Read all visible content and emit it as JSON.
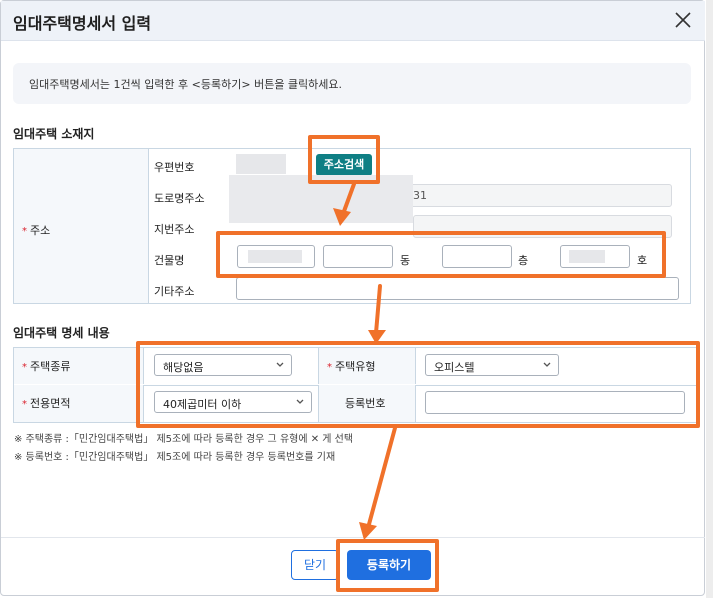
{
  "dialog": {
    "title": "임대주택명세서 입력",
    "notice": "임대주택명세서는 1건씩 입력한 후 <등록하기> 버튼을 클릭하세요."
  },
  "location": {
    "section_title": "임대주택 소재지",
    "address_label": "주소",
    "postal_label": "우편번호",
    "search_button": "주소검색",
    "road_label": "도로명주소",
    "road_value_suffix": "31",
    "lot_label": "지번주소",
    "building_label": "건물명",
    "dong_unit": "동",
    "floor_unit": "층",
    "ho_unit": "호",
    "extra_label": "기타주소"
  },
  "details": {
    "section_title": "임대주택 명세 내용",
    "house_kind_label": "주택종류",
    "house_kind_value": "해당없음",
    "house_type_label": "주택유형",
    "house_type_value": "오피스텔",
    "area_label": "전용면적",
    "area_value": "40제곱미터 이하",
    "reg_no_label": "등록번호"
  },
  "notes": [
    "※ 주택종류 :「민간임대주택법」 제5조에 따라 등록한 경우 그 유형에 ✕ 게 선택",
    "※ 등록번호 :「민간임대주택법」 제5조에 따라 등록한 경우 등록번호를 기재"
  ],
  "footer": {
    "close_button": "닫기",
    "register_button": "등록하기"
  },
  "colors": {
    "highlight": "#f0712a",
    "primary": "#1f6fe0",
    "search_button": "#0f7f84",
    "required": "#d9232e"
  }
}
